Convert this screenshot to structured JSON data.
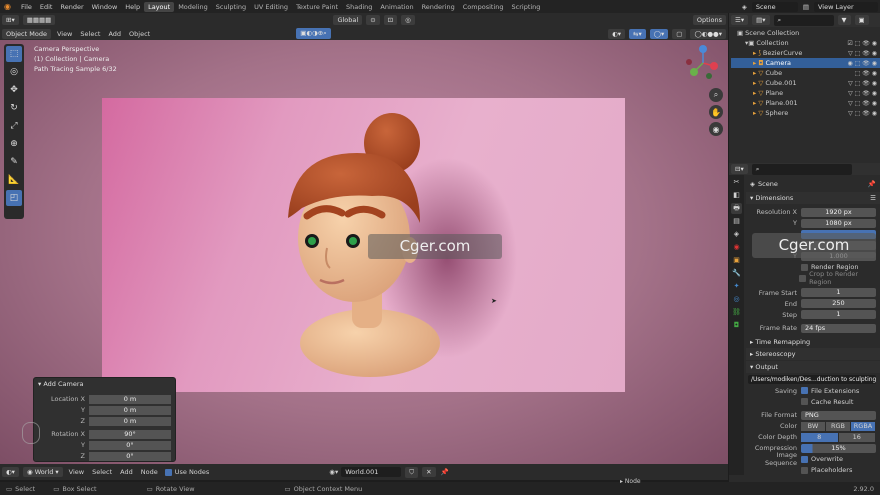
{
  "menu": [
    "File",
    "Edit",
    "Render",
    "Window",
    "Help"
  ],
  "workspaces": [
    "Layout",
    "Modeling",
    "Sculpting",
    "UV Editing",
    "Texture Paint",
    "Shading",
    "Animation",
    "Rendering",
    "Compositing",
    "Scripting"
  ],
  "scene_label": "Scene",
  "view_layer_label": "View Layer",
  "viewport_header": {
    "mode": "Object Mode",
    "view": "View",
    "select": "Select",
    "add": "Add",
    "object": "Object",
    "orientation": "Global",
    "options": "Options"
  },
  "overlay": {
    "line1": "Camera Perspective",
    "line2": "(1) Collection | Camera",
    "line3": "Path Tracing Sample 6/32"
  },
  "add_camera": {
    "title": "Add Camera",
    "rows": [
      {
        "label": "Location X",
        "value": "0 m"
      },
      {
        "label": "Y",
        "value": "0 m"
      },
      {
        "label": "Z",
        "value": "0 m"
      },
      {
        "label": "Rotation X",
        "value": "90°"
      },
      {
        "label": "Y",
        "value": "0°"
      },
      {
        "label": "Z",
        "value": "0°"
      }
    ]
  },
  "bottom_header": {
    "world": "World",
    "view": "View",
    "select": "Select",
    "add": "Add",
    "node": "Node",
    "use_nodes": "Use Nodes",
    "world_name": "World.001",
    "node_tab": "Node"
  },
  "status": {
    "select": "Select",
    "box_select": "Box Select",
    "rotate_view": "Rotate View",
    "context_menu": "Object Context Menu",
    "version": "2.92.0"
  },
  "outliner": {
    "root": "Scene Collection",
    "collection": "Collection",
    "items": [
      "BezierCurve",
      "Camera",
      "Cube",
      "Cube.001",
      "Plane",
      "Plane.001",
      "Sphere"
    ]
  },
  "properties": {
    "scene": "Scene",
    "dimensions": "Dimensions",
    "resolution_x_label": "Resolution X",
    "resolution_x": "1920 px",
    "y_label": "Y",
    "resolution_y": "1080 px",
    "aspect_y": "1.000",
    "render_region": "Render Region",
    "crop": "Crop to Render Region",
    "frame_start_label": "Frame Start",
    "frame_start": "1",
    "end_label": "End",
    "frame_end": "250",
    "step_label": "Step",
    "step": "1",
    "frame_rate_label": "Frame Rate",
    "frame_rate": "24 fps",
    "time_remapping": "Time Remapping",
    "stereoscopy": "Stereoscopy",
    "output": "Output",
    "output_path": "/Users/modiken/Des...duction to sculpting/",
    "saving": "Saving",
    "file_extensions": "File Extensions",
    "cache_result": "Cache Result",
    "file_format_label": "File Format",
    "file_format": "PNG",
    "color_label": "Color",
    "color_opts": [
      "BW",
      "RGB",
      "RGBA"
    ],
    "color_depth_label": "Color Depth",
    "depth_opts": [
      "8",
      "16"
    ],
    "compression_label": "Compression",
    "compression": "15%",
    "image_sequence": "Image Sequence",
    "overwrite": "Overwrite",
    "placeholders": "Placeholders"
  },
  "watermark": "Cger.com",
  "colors": {
    "accent": "#4772b3",
    "selection": "#335f99",
    "hair": "#b5522c",
    "skin": "#f0c49a"
  }
}
